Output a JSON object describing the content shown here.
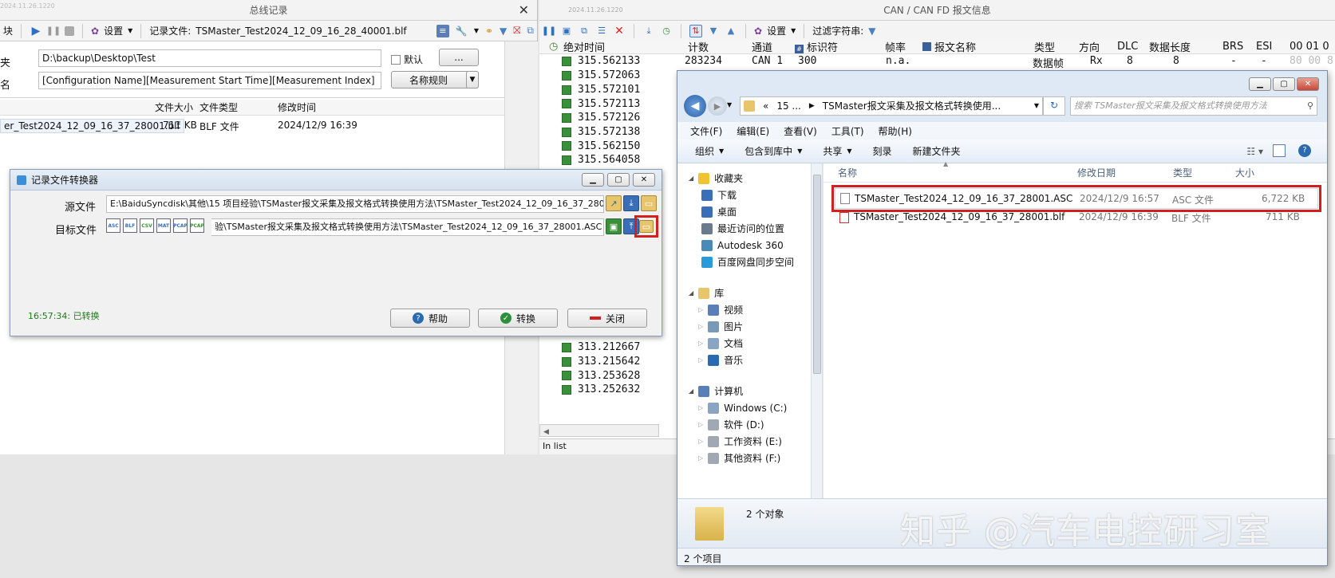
{
  "left_panel": {
    "title": "总线记录",
    "toolbar": {
      "module_label": "块",
      "settings_label": "设置",
      "record_file_label": "记录文件:",
      "record_file_value": "TSMaster_Test2024_12_09_16_28_40001.blf"
    },
    "folder_label": "夹",
    "folder_value": "D:\\backup\\Desktop\\Test",
    "default_checkbox_label": "默认",
    "browse_button": "...",
    "name_label": "名",
    "name_value": "[Configuration Name][Measurement Start Time][Measurement Index]",
    "naming_rule_button": "名称规则",
    "columns": [
      "文件大小",
      "文件类型",
      "修改时间"
    ],
    "file_row": {
      "name": "er_Test2024_12_09_16_37_28001.blf",
      "size": "711 KB",
      "type": "BLF 文件",
      "modified": "2024/12/9 16:39"
    }
  },
  "converter": {
    "title": "记录文件转换器",
    "source_label": "源文件",
    "source_value": "E:\\BaiduSyncdisk\\其他\\15 项目经验\\TSMaster报文采集及报文格式转换使用方法\\TSMaster_Test2024_12_09_16_37_2800",
    "target_label": "目标文件",
    "format_buttons": [
      "ASC",
      "BLF",
      "CSV",
      "MAT",
      "PCAP",
      "PCAP"
    ],
    "target_value": "验\\TSMaster报文采集及报文格式转换使用方法\\TSMaster_Test2024_12_09_16_37_28001.ASC",
    "status": "16:57:34: 已转换",
    "help_button": "帮助",
    "convert_button": "转换",
    "close_button": "关闭"
  },
  "can_panel": {
    "title": "CAN / CAN FD 报文信息",
    "version": "2024.11.26.1220",
    "settings_label": "设置",
    "filter_label": "过滤字符串:",
    "columns": [
      "绝对时间",
      "计数",
      "通道",
      "标识符",
      "帧率",
      "报文名称",
      "类型",
      "方向",
      "DLC",
      "数据长度",
      "BRS",
      "ESI",
      "00 01 0"
    ],
    "first_row": {
      "time": "315.562133",
      "count": "283234",
      "channel": "CAN 1",
      "id": "300",
      "rate": "n.a.",
      "type": "数据帧",
      "dir": "Rx",
      "dlc": "8",
      "len": "8",
      "brs": "-",
      "esi": "-",
      "data": "80 00 8"
    },
    "times": [
      "315.572063",
      "315.572101",
      "315.572113",
      "315.572126",
      "315.572138",
      "315.562150",
      "315.564058"
    ],
    "times_bottom": [
      "313.212667",
      "313.215642",
      "313.253628",
      "313.252632"
    ],
    "status": "In list",
    "left_version": "2024.11.26.1220"
  },
  "explorer": {
    "path_parts": [
      "«",
      "15 ...",
      "TSMaster报文采集及报文格式转换使用..."
    ],
    "search_placeholder": "搜索 TSMaster报文采集及报文格式转换使用方法",
    "menu": [
      "文件(F)",
      "编辑(E)",
      "查看(V)",
      "工具(T)",
      "帮助(H)"
    ],
    "toolbar": [
      "组织",
      "包含到库中",
      "共享",
      "刻录",
      "新建文件夹"
    ],
    "nav": {
      "favorites": "收藏夹",
      "fav_items": [
        "下载",
        "桌面",
        "最近访问的位置",
        "Autodesk 360",
        "百度网盘同步空间"
      ],
      "library": "库",
      "lib_items": [
        "视频",
        "图片",
        "文档",
        "音乐"
      ],
      "computer": "计算机",
      "drives": [
        "Windows (C:)",
        "软件 (D:)",
        "工作资料 (E:)",
        "其他资料 (F:)"
      ]
    },
    "columns": [
      "名称",
      "修改日期",
      "类型",
      "大小"
    ],
    "files": [
      {
        "name": "TSMaster_Test2024_12_09_16_37_28001.ASC",
        "date": "2024/12/9 16:57",
        "type": "ASC 文件",
        "size": "6,722 KB"
      },
      {
        "name": "TSMaster_Test2024_12_09_16_37_28001.blf",
        "date": "2024/12/9 16:39",
        "type": "BLF 文件",
        "size": "711 KB"
      }
    ],
    "details_count": "2 个对象",
    "status_count": "2 个项目"
  },
  "watermark": "知乎 @汽车电控研习室",
  "colors": {
    "highlight_red": "#d21f1f",
    "green": "#3a8f3a",
    "status_green": "#1f7a1f"
  }
}
